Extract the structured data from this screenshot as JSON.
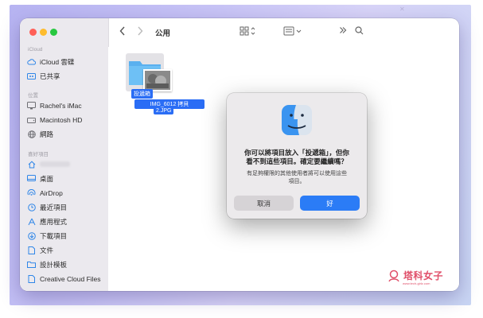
{
  "window": {
    "folder_title": "公用"
  },
  "sidebar": {
    "sections": [
      {
        "title": "iCloud",
        "items": [
          {
            "label": "iCloud 雲碟",
            "icon": "cloud-icon"
          },
          {
            "label": "已共享",
            "icon": "shared-folder-icon"
          }
        ]
      },
      {
        "title": "位置",
        "items": [
          {
            "label": "Rachel's iMac",
            "icon": "imac-icon"
          },
          {
            "label": "Macintosh HD",
            "icon": "hard-drive-icon"
          },
          {
            "label": "網路",
            "icon": "network-globe-icon"
          }
        ]
      },
      {
        "title": "喜好項目",
        "items": [
          {
            "label": "",
            "icon": "home-icon"
          },
          {
            "label": "桌面",
            "icon": "desktop-icon"
          },
          {
            "label": "AirDrop",
            "icon": "airdrop-icon"
          },
          {
            "label": "最近項目",
            "icon": "clock-icon"
          },
          {
            "label": "應用程式",
            "icon": "applications-icon"
          },
          {
            "label": "下載項目",
            "icon": "download-icon"
          },
          {
            "label": "文件",
            "icon": "document-icon"
          },
          {
            "label": "設計模板",
            "icon": "folder-icon"
          },
          {
            "label": "Creative Cloud Files",
            "icon": "creative-cloud-files-icon"
          }
        ]
      }
    ]
  },
  "content": {
    "folder_label": "投遞箱",
    "file_label_line1": "IMG_6012 拷貝",
    "file_label_line2": "2.JPG"
  },
  "dialog": {
    "title_line1": "你可以將項目放入「投遞箱」，但你",
    "title_line2": "看不到這些項目。確定要繼續嗎？",
    "message_line1": "有足夠權限的其他使用者將可以使用這些",
    "message_line2": "項目。",
    "cancel_label": "取消",
    "ok_label": "好"
  },
  "watermark": {
    "text": "塔科女子",
    "sub": "www.tech-girlz.com"
  },
  "colors": {
    "accent": "#2b7cf6",
    "sidebar_bg": "#ebe9ee",
    "dialog_bg": "#eceaec"
  }
}
